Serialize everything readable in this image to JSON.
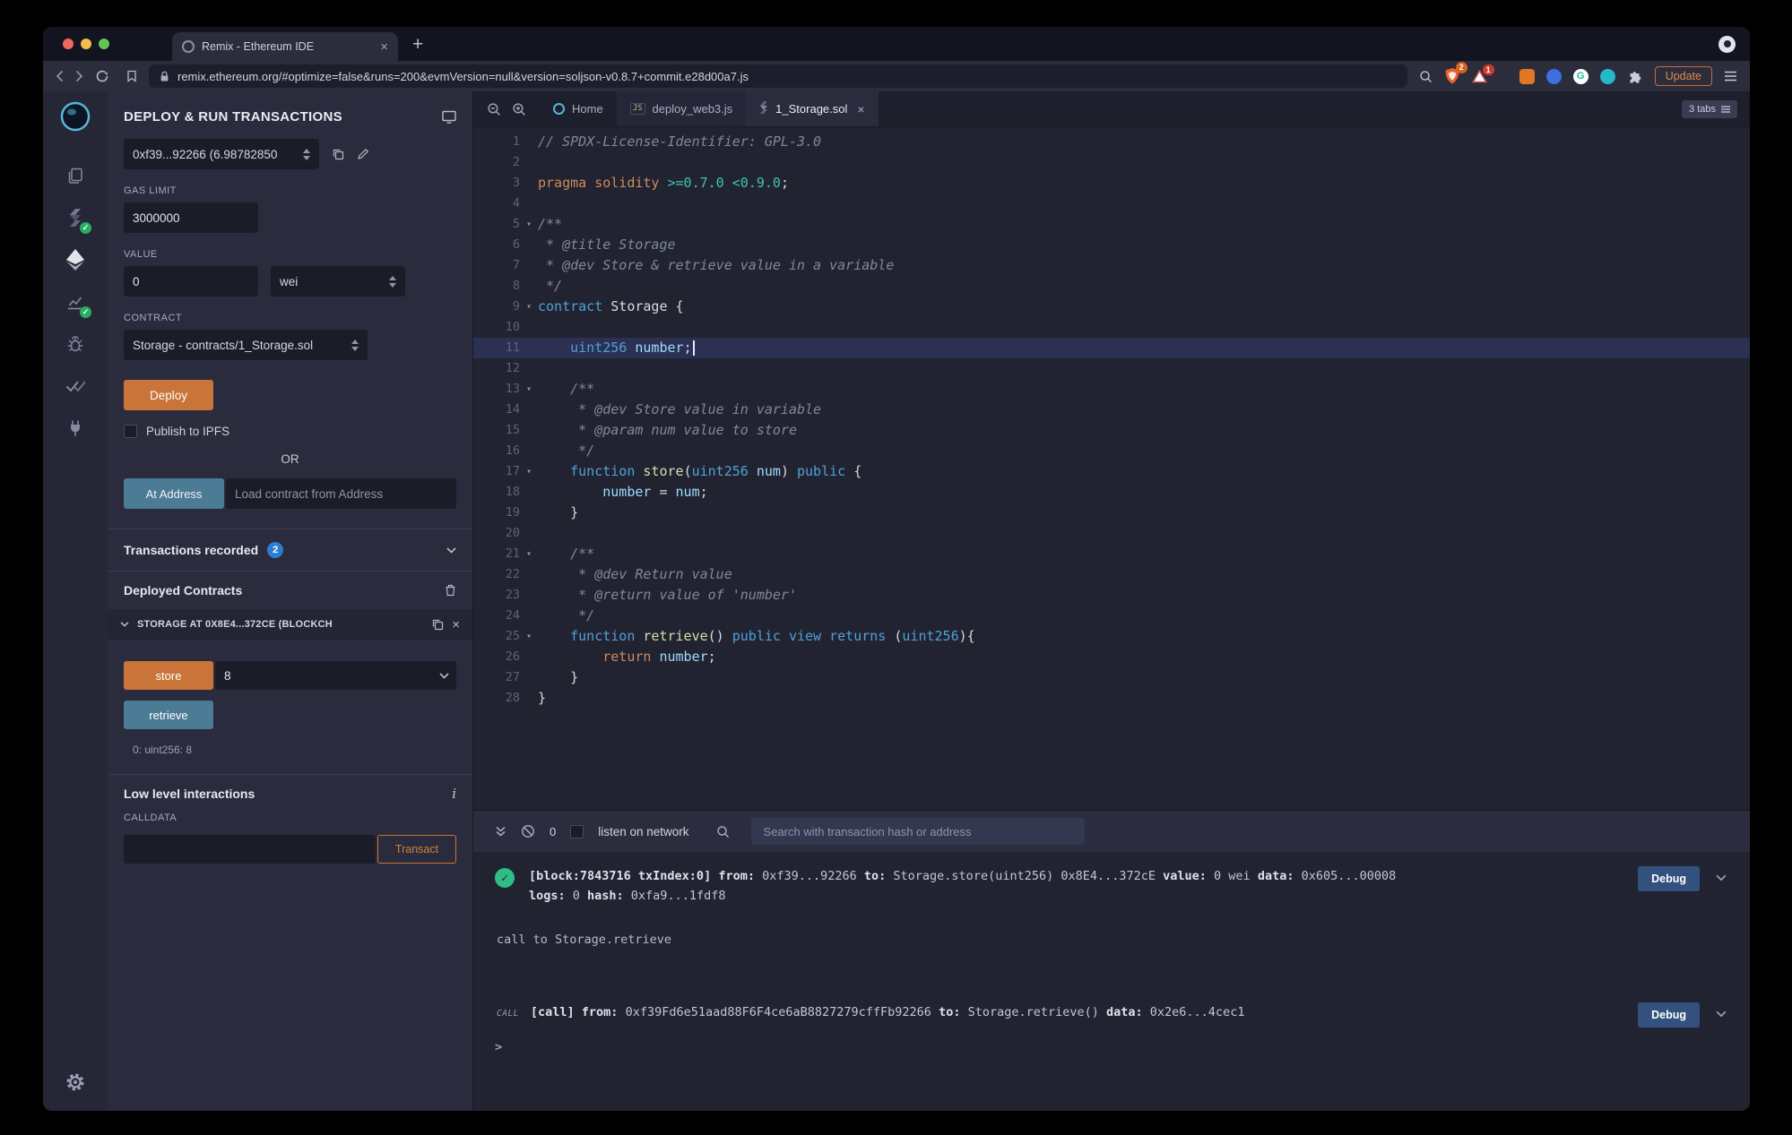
{
  "glyphs": {
    "close": "×",
    "plus": "+",
    "fold": "▾",
    "check": "✓",
    "ext_g": "G",
    "js": "JS"
  },
  "browser": {
    "tab_title": "Remix - Ethereum IDE",
    "url": "remix.ethereum.org/#optimize=false&runs=200&evmVersion=null&version=soljson-v0.8.7+commit.e28d00a7.js",
    "shield_badge": "2",
    "rewards_badge": "1",
    "update_label": "Update"
  },
  "panel": {
    "title": "DEPLOY & RUN TRANSACTIONS",
    "account_value": "0xf39...92266 (6.98782850",
    "gas_label": "GAS LIMIT",
    "gas_value": "3000000",
    "value_label": "VALUE",
    "value_amount": "0",
    "value_unit": "wei",
    "contract_label": "CONTRACT",
    "contract_value": "Storage - contracts/1_Storage.sol",
    "deploy_label": "Deploy",
    "publish_label": "Publish to IPFS",
    "or_label": "OR",
    "at_address_label": "At Address",
    "at_address_placeholder": "Load contract from Address",
    "tx_recorded_label": "Transactions recorded",
    "tx_recorded_count": "2",
    "deployed_label": "Deployed Contracts",
    "deployed_contract_title": "STORAGE AT 0X8E4...372CE (BLOCKCH",
    "store_label": "store",
    "store_value": "8",
    "retrieve_label": "retrieve",
    "retrieve_result": "0: uint256: 8",
    "low_level_label": "Low level interactions",
    "calldata_label": "CALLDATA",
    "transact_label": "Transact"
  },
  "tabsbar": {
    "home_label": "Home",
    "js_tab_label": "deploy_web3.js",
    "sol_tab_label": "1_Storage.sol",
    "tabs_count": "3 tabs"
  },
  "editor": {
    "lines": [
      {
        "n": 1,
        "t": [
          [
            "c",
            "// SPDX-License-Identifier: GPL-3.0"
          ]
        ]
      },
      {
        "n": 2
      },
      {
        "n": 3,
        "t": [
          [
            "p",
            "pragma solidity "
          ],
          [
            "n",
            ">=0.7.0 <0.9.0"
          ],
          [
            "w",
            ";"
          ]
        ]
      },
      {
        "n": 4
      },
      {
        "n": 5,
        "fold": true,
        "t": [
          [
            "c",
            "/**"
          ]
        ]
      },
      {
        "n": 6,
        "t": [
          [
            "c",
            " * @title Storage"
          ]
        ]
      },
      {
        "n": 7,
        "t": [
          [
            "c",
            " * @dev Store & retrieve value in a variable"
          ]
        ]
      },
      {
        "n": 8,
        "t": [
          [
            "c",
            " */"
          ]
        ]
      },
      {
        "n": 9,
        "fold": true,
        "t": [
          [
            "k",
            "contract"
          ],
          [
            "w",
            " Storage {"
          ]
        ]
      },
      {
        "n": 10
      },
      {
        "n": 11,
        "hl": true,
        "cursor": true,
        "t": [
          [
            "w",
            "    "
          ],
          [
            "k",
            "uint256"
          ],
          [
            "w",
            " "
          ],
          [
            "v",
            "number"
          ],
          [
            "w",
            ";"
          ]
        ]
      },
      {
        "n": 12
      },
      {
        "n": 13,
        "fold": true,
        "t": [
          [
            "w",
            "    "
          ],
          [
            "c",
            "/**"
          ]
        ]
      },
      {
        "n": 14,
        "t": [
          [
            "w",
            "    "
          ],
          [
            "c",
            " * @dev Store value in variable"
          ]
        ]
      },
      {
        "n": 15,
        "t": [
          [
            "w",
            "    "
          ],
          [
            "c",
            " * @param num value to store"
          ]
        ]
      },
      {
        "n": 16,
        "t": [
          [
            "w",
            "    "
          ],
          [
            "c",
            " */"
          ]
        ]
      },
      {
        "n": 17,
        "fold": true,
        "t": [
          [
            "w",
            "    "
          ],
          [
            "k",
            "function"
          ],
          [
            "w",
            " "
          ],
          [
            "f",
            "store"
          ],
          [
            "w",
            "("
          ],
          [
            "k",
            "uint256"
          ],
          [
            "w",
            " "
          ],
          [
            "v",
            "num"
          ],
          [
            "w",
            ") "
          ],
          [
            "k",
            "public"
          ],
          [
            "w",
            " {"
          ]
        ]
      },
      {
        "n": 18,
        "t": [
          [
            "w",
            "        "
          ],
          [
            "v",
            "number"
          ],
          [
            "w",
            " = "
          ],
          [
            "v",
            "num"
          ],
          [
            "w",
            ";"
          ]
        ]
      },
      {
        "n": 19,
        "t": [
          [
            "w",
            "    }"
          ]
        ]
      },
      {
        "n": 20
      },
      {
        "n": 21,
        "fold": true,
        "t": [
          [
            "w",
            "    "
          ],
          [
            "c",
            "/**"
          ]
        ]
      },
      {
        "n": 22,
        "t": [
          [
            "w",
            "    "
          ],
          [
            "c",
            " * @dev Return value"
          ]
        ]
      },
      {
        "n": 23,
        "t": [
          [
            "w",
            "    "
          ],
          [
            "c",
            " * @return value of 'number'"
          ]
        ]
      },
      {
        "n": 24,
        "t": [
          [
            "w",
            "    "
          ],
          [
            "c",
            " */"
          ]
        ]
      },
      {
        "n": 25,
        "fold": true,
        "t": [
          [
            "w",
            "    "
          ],
          [
            "k",
            "function"
          ],
          [
            "w",
            " "
          ],
          [
            "f",
            "retrieve"
          ],
          [
            "w",
            "() "
          ],
          [
            "k",
            "public"
          ],
          [
            "w",
            " "
          ],
          [
            "k",
            "view"
          ],
          [
            "w",
            " "
          ],
          [
            "k",
            "returns"
          ],
          [
            "w",
            " ("
          ],
          [
            "k",
            "uint256"
          ],
          [
            "w",
            "){"
          ]
        ]
      },
      {
        "n": 26,
        "t": [
          [
            "w",
            "        "
          ],
          [
            "p",
            "return"
          ],
          [
            "w",
            " "
          ],
          [
            "v",
            "number"
          ],
          [
            "w",
            ";"
          ]
        ]
      },
      {
        "n": 27,
        "t": [
          [
            "w",
            "    }"
          ]
        ]
      },
      {
        "n": 28,
        "t": [
          [
            "w",
            "}"
          ]
        ]
      }
    ]
  },
  "terminal": {
    "pending_count": "0",
    "listen_label": "listen on network",
    "search_placeholder": "Search with transaction hash or address",
    "prompt": ">",
    "logs": [
      {
        "kind": "tx",
        "lines": [
          [
            [
              "b",
              "[block:7843716 txIndex:0] "
            ],
            [
              "b",
              "from:"
            ],
            [
              "v",
              " 0xf39...92266 "
            ],
            [
              "b",
              "to:"
            ],
            [
              "v",
              " Storage.store(uint256) 0x8E4...372cE "
            ],
            [
              "b",
              "value:"
            ],
            [
              "v",
              " 0 wei "
            ],
            [
              "b",
              "data:"
            ],
            [
              "v",
              " 0x605...00008 "
            ]
          ],
          [
            [
              "b",
              "logs:"
            ],
            [
              "v",
              " 0 "
            ],
            [
              "b",
              "hash:"
            ],
            [
              "v",
              " 0xfa9...1fdf8"
            ]
          ]
        ],
        "button": "Debug"
      },
      {
        "kind": "text",
        "text": "call to Storage.retrieve"
      },
      {
        "kind": "call",
        "prefix": "call",
        "lines": [
          [
            [
              "b",
              "[call] "
            ],
            [
              "b",
              "from:"
            ],
            [
              "v",
              " 0xf39Fd6e51aad88F6F4ce6aB8827279cffFb92266 "
            ],
            [
              "b",
              "to:"
            ],
            [
              "v",
              " Storage.retrieve() "
            ],
            [
              "b",
              "data:"
            ],
            [
              "v",
              " 0x2e6...4cec1"
            ]
          ]
        ],
        "button": "Debug"
      }
    ]
  }
}
